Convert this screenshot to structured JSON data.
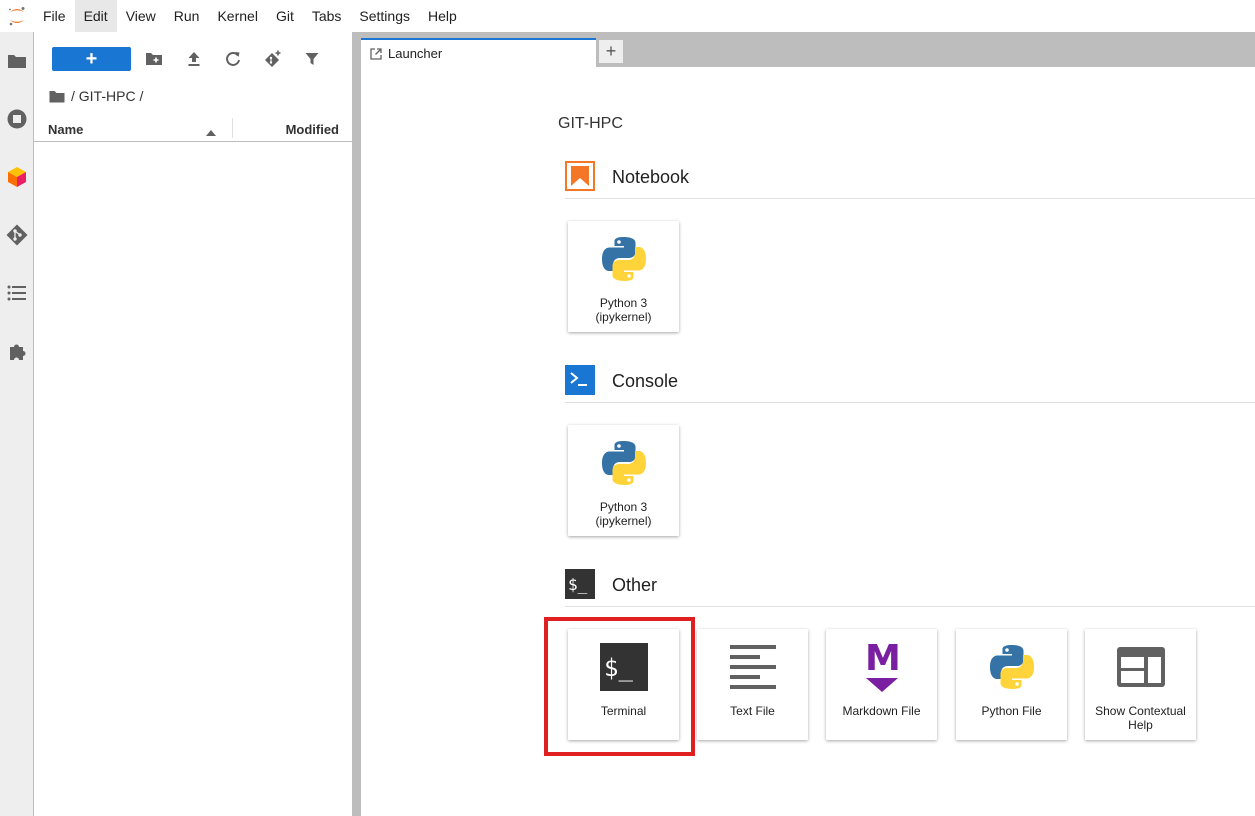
{
  "menubar": {
    "items": [
      "File",
      "Edit",
      "View",
      "Run",
      "Kernel",
      "Git",
      "Tabs",
      "Settings",
      "Help"
    ],
    "active": "Edit"
  },
  "activity_bar": {
    "icons": [
      "folder-icon",
      "running-icon",
      "cube-icon",
      "git-icon",
      "list-icon",
      "puzzle-icon"
    ]
  },
  "file_browser": {
    "new_button_label": "+",
    "breadcrumb": "/ GIT-HPC /",
    "columns": {
      "name": "Name",
      "modified": "Modified"
    },
    "rows": []
  },
  "tabs": {
    "launcher_label": "Launcher",
    "new_tab_label": "+"
  },
  "launcher": {
    "cwd": "GIT-HPC",
    "sections": {
      "notebook": {
        "title": "Notebook",
        "cards": [
          "Python 3\n(ipykernel)"
        ]
      },
      "console": {
        "title": "Console",
        "cards": [
          "Python 3\n(ipykernel)"
        ]
      },
      "other": {
        "title": "Other",
        "cards": [
          "Terminal",
          "Text File",
          "Markdown File",
          "Python File",
          "Show Contextual Help"
        ]
      }
    }
  },
  "colors": {
    "accent": "#1976d2",
    "highlight": "#e02020",
    "notebook": "#f37726",
    "markdown": "#7b1fa2",
    "python_blue": "#3572a5",
    "python_yellow": "#ffd43b"
  }
}
